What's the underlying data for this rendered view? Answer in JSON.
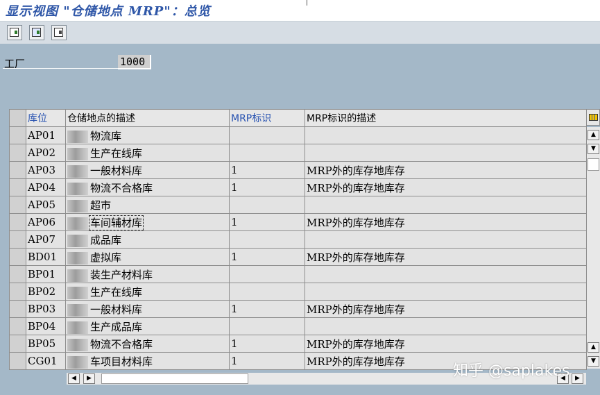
{
  "title": "显示视图 \"仓储地点 MRP\"：总览",
  "toolbar": {
    "buttons": [
      {
        "icon": "details-icon"
      },
      {
        "icon": "select-all-icon"
      },
      {
        "icon": "deselect-icon"
      }
    ]
  },
  "plant": {
    "label": "工厂",
    "value": "1000"
  },
  "table": {
    "columns": [
      "库位",
      "仓储地点的描述",
      "MRP标识",
      "MRP标识的描述"
    ],
    "rows": [
      {
        "code": "AP01",
        "desc": "物流库",
        "mrp": "",
        "mrp_desc": ""
      },
      {
        "code": "AP02",
        "desc": "生产在线库",
        "mrp": "",
        "mrp_desc": ""
      },
      {
        "code": "AP03",
        "desc": "一般材料库",
        "mrp": "1",
        "mrp_desc": "MRP外的库存地库存"
      },
      {
        "code": "AP04",
        "desc": "物流不合格库",
        "mrp": "1",
        "mrp_desc": "MRP外的库存地库存"
      },
      {
        "code": "AP05",
        "desc": "超市",
        "mrp": "",
        "mrp_desc": ""
      },
      {
        "code": "AP06",
        "desc": "车间辅材库",
        "mrp": "1",
        "mrp_desc": "MRP外的库存地库存"
      },
      {
        "code": "AP07",
        "desc": "成品库",
        "mrp": "",
        "mrp_desc": ""
      },
      {
        "code": "BD01",
        "desc": "虚拟库",
        "mrp": "1",
        "mrp_desc": "MRP外的库存地库存"
      },
      {
        "code": "BP01",
        "desc": "装生产材料库",
        "mrp": "",
        "mrp_desc": ""
      },
      {
        "code": "BP02",
        "desc": "生产在线库",
        "mrp": "",
        "mrp_desc": ""
      },
      {
        "code": "BP03",
        "desc": "一般材料库",
        "mrp": "1",
        "mrp_desc": "MRP外的库存地库存"
      },
      {
        "code": "BP04",
        "desc": "生产成品库",
        "mrp": "",
        "mrp_desc": ""
      },
      {
        "code": "BP05",
        "desc": "物流不合格库",
        "mrp": "1",
        "mrp_desc": "MRP外的库存地库存"
      },
      {
        "code": "CG01",
        "desc": "车项目材料库",
        "mrp": "1",
        "mrp_desc": "MRP外的库存地库存"
      }
    ]
  },
  "watermark": "知乎 @saplakes"
}
